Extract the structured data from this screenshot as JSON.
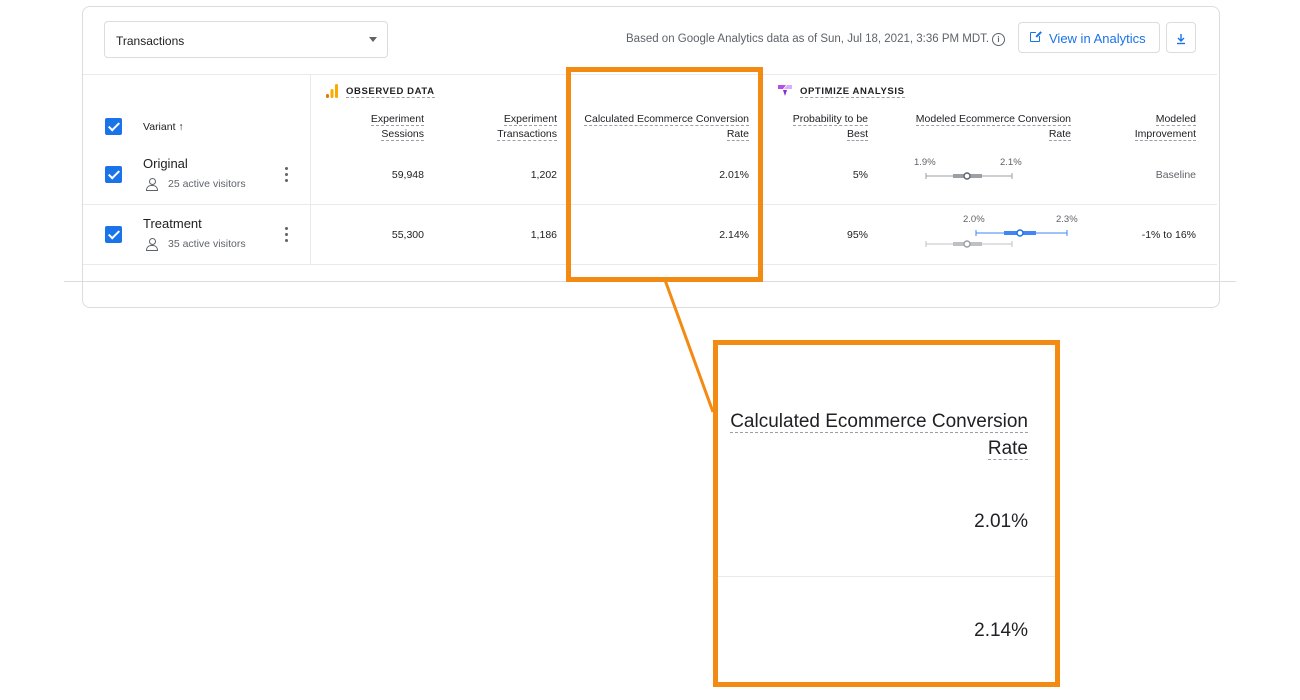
{
  "toolbar": {
    "metric_select": "Transactions",
    "as_of_text": "Based on Google Analytics data as of Sun, Jul 18, 2021, 3:36 PM MDT.",
    "view_button": "View in Analytics"
  },
  "sections": {
    "observed": "OBSERVED DATA",
    "optimize": "OPTIMIZE ANALYSIS"
  },
  "columns": {
    "variant": "Variant",
    "sort_arrow": "↑",
    "sessions_1": "Experiment",
    "sessions_2": "Sessions",
    "transactions_1": "Experiment",
    "transactions_2": "Transactions",
    "conv_1": "Calculated Ecommerce Conversion",
    "conv_2": "Rate",
    "prob_1": "Probability to be",
    "prob_2": "Best",
    "modeled_conv_1": "Modeled Ecommerce Conversion",
    "modeled_conv_2": "Rate",
    "improve_1": "Modeled",
    "improve_2": "Improvement"
  },
  "rows": [
    {
      "name": "Original",
      "visitors": "25 active visitors",
      "sessions": "59,948",
      "transactions": "1,202",
      "conversion_rate": "2.01%",
      "probability": "5%",
      "range_low": "1.9%",
      "range_high": "2.1%",
      "improvement": "Baseline"
    },
    {
      "name": "Treatment",
      "visitors": "35 active visitors",
      "sessions": "55,300",
      "transactions": "1,186",
      "conversion_rate": "2.14%",
      "probability": "95%",
      "range_low": "2.0%",
      "range_high": "2.3%",
      "improvement": "-1% to 16%"
    }
  ],
  "colors": {
    "accent_blue": "#1a73e8",
    "highlight_orange": "#f38a12",
    "analytics_orange": "#f9ab00",
    "optimize_purple": "#b64fe3",
    "neutral_gray": "#9aa0a6"
  },
  "icons": {
    "dropdown": "caret-down-icon",
    "info": "info-icon",
    "external_link": "open-in-new-icon",
    "download": "download-icon",
    "analytics": "analytics-icon",
    "optimize": "optimize-icon",
    "person": "person-icon",
    "menu": "more-vert-icon"
  }
}
